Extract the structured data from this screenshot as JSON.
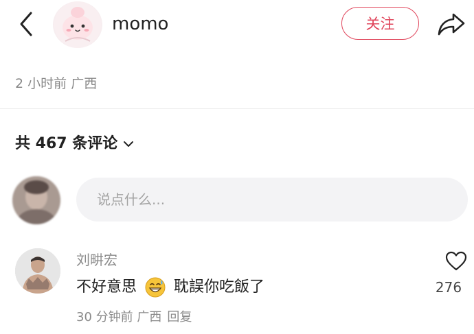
{
  "header": {
    "author_name": "momo",
    "follow_label": "关注",
    "icons": {
      "back": "chevron-left-icon",
      "share": "share-arrow-icon"
    }
  },
  "post": {
    "time": "2 小时前",
    "location": "广西"
  },
  "comments_section": {
    "count_label": "共 467 条评论",
    "input_placeholder": "说点什么..."
  },
  "comments": [
    {
      "username": "刘畊宏",
      "text_before": "不好意思",
      "emoji": "grinning-sweat-emoji",
      "text_after": "耽誤你吃飯了",
      "time": "30 分钟前",
      "location": "广西",
      "reply_label": "回复",
      "likes": "276"
    }
  ],
  "colors": {
    "accent": "#e0455b",
    "muted_text": "#8a8a8a",
    "input_bg": "#f3f3f5"
  }
}
